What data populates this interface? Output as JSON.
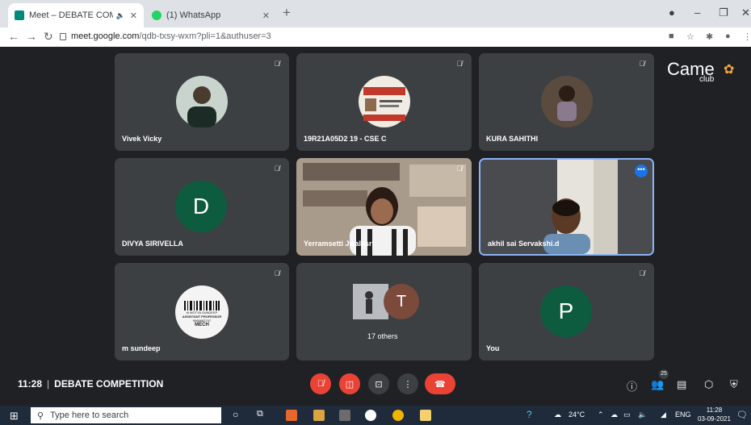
{
  "browser": {
    "tabs": [
      {
        "title": "Meet – DEBATE COMPETITIO",
        "active": true
      },
      {
        "title": "(1) WhatsApp",
        "active": false
      }
    ],
    "url_host": "meet.google.com",
    "url_path": "/qdb-txsy-wxm?pli=1&authuser=3"
  },
  "meet": {
    "logo_text": "Came",
    "logo_sub": "club",
    "participants": [
      {
        "name": "Vivek Vicky"
      },
      {
        "name": "19R21A05D2 19 - CSE C"
      },
      {
        "name": "KURA SAHITHI"
      },
      {
        "name": "DIVYA SIRIVELLA",
        "initial": "D"
      },
      {
        "name": "Yerramsetti Jwalasri"
      },
      {
        "name": "akhil sai Servakshi.d"
      },
      {
        "name": "m sundeep"
      },
      {
        "name": "17 others",
        "initial": "T"
      },
      {
        "name": "You",
        "initial": "P"
      }
    ],
    "id_card_lines": [
      "M MOTYA SUNDEEP",
      "ASSISTANT PROFESSOR",
      "9966682747",
      "MECH"
    ],
    "time": "11:28",
    "meeting_title": "DEBATE COMPETITION",
    "people_count": "25"
  },
  "taskbar": {
    "search_placeholder": "Type here to search",
    "temperature": "24°C",
    "language": "ENG",
    "clock_time": "11:28",
    "clock_date": "03-09-2021"
  },
  "colors": {
    "tile_bg": "#3c4043",
    "meet_bg": "#202124",
    "accent_red": "#ea4335",
    "avatar_green": "#0d5c3f",
    "active_border": "#8ab4f8"
  }
}
